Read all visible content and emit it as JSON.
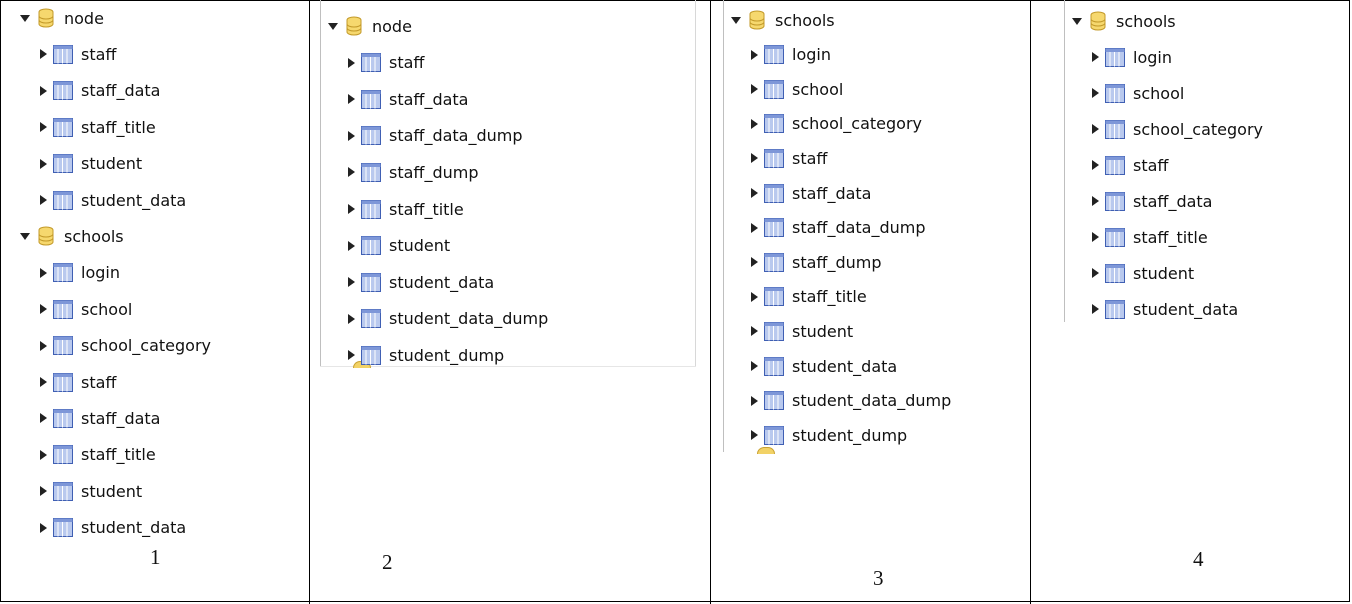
{
  "panels": [
    {
      "caption": "1",
      "rows": [
        {
          "type": "db",
          "label": "node",
          "state": "expanded"
        },
        {
          "type": "table",
          "label": "staff"
        },
        {
          "type": "table",
          "label": "staff_data"
        },
        {
          "type": "table",
          "label": "staff_title"
        },
        {
          "type": "table",
          "label": "student"
        },
        {
          "type": "table",
          "label": "student_data"
        },
        {
          "type": "db",
          "label": "schools",
          "state": "expanded"
        },
        {
          "type": "table",
          "label": "login"
        },
        {
          "type": "table",
          "label": "school"
        },
        {
          "type": "table",
          "label": "school_category"
        },
        {
          "type": "table",
          "label": "staff"
        },
        {
          "type": "table",
          "label": "staff_data"
        },
        {
          "type": "table",
          "label": "staff_title"
        },
        {
          "type": "table",
          "label": "student"
        },
        {
          "type": "table",
          "label": "student_data"
        }
      ]
    },
    {
      "caption": "2",
      "rows": [
        {
          "type": "db",
          "label": "node",
          "state": "expanded"
        },
        {
          "type": "table",
          "label": "staff"
        },
        {
          "type": "table",
          "label": "staff_data"
        },
        {
          "type": "table",
          "label": "staff_data_dump"
        },
        {
          "type": "table",
          "label": "staff_dump"
        },
        {
          "type": "table",
          "label": "staff_title"
        },
        {
          "type": "table",
          "label": "student"
        },
        {
          "type": "table",
          "label": "student_data"
        },
        {
          "type": "table",
          "label": "student_data_dump"
        },
        {
          "type": "table",
          "label": "student_dump"
        }
      ]
    },
    {
      "caption": "3",
      "rows": [
        {
          "type": "db",
          "label": "schools",
          "state": "expanded"
        },
        {
          "type": "table",
          "label": "login"
        },
        {
          "type": "table",
          "label": "school"
        },
        {
          "type": "table",
          "label": "school_category"
        },
        {
          "type": "table",
          "label": "staff"
        },
        {
          "type": "table",
          "label": "staff_data"
        },
        {
          "type": "table",
          "label": "staff_data_dump"
        },
        {
          "type": "table",
          "label": "staff_dump"
        },
        {
          "type": "table",
          "label": "staff_title"
        },
        {
          "type": "table",
          "label": "student"
        },
        {
          "type": "table",
          "label": "student_data"
        },
        {
          "type": "table",
          "label": "student_data_dump"
        },
        {
          "type": "table",
          "label": "student_dump"
        }
      ]
    },
    {
      "caption": "4",
      "rows": [
        {
          "type": "db",
          "label": "schools",
          "state": "expanded"
        },
        {
          "type": "table",
          "label": "login"
        },
        {
          "type": "table",
          "label": "school"
        },
        {
          "type": "table",
          "label": "school_category"
        },
        {
          "type": "table",
          "label": "staff"
        },
        {
          "type": "table",
          "label": "staff_data"
        },
        {
          "type": "table",
          "label": "staff_title"
        },
        {
          "type": "table",
          "label": "student"
        },
        {
          "type": "table",
          "label": "student_data"
        }
      ]
    }
  ],
  "colors": {
    "db_icon_fill": "#f6d86e",
    "db_icon_stroke": "#c39a2a",
    "table_icon_fill": "#b9c9ee",
    "table_icon_stroke": "#3f5fb3",
    "grid_line": "#000000"
  }
}
